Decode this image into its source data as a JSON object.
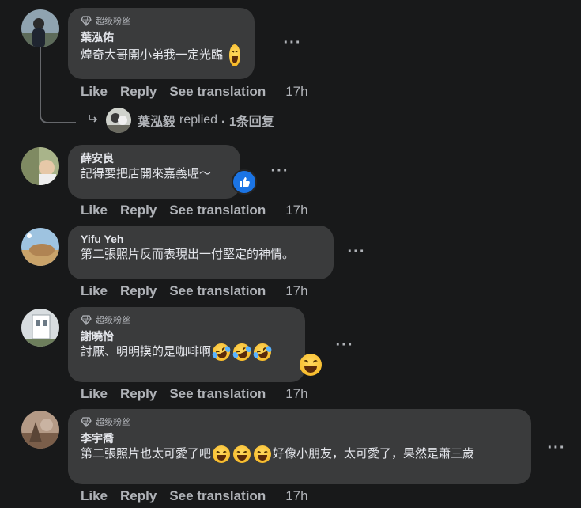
{
  "badge_label": "超级粉丝",
  "actions": {
    "like": "Like",
    "reply": "Reply",
    "translate": "See translation"
  },
  "comments": [
    {
      "author": "葉泓佑",
      "text": "煌奇大哥開小弟我一定光臨",
      "time": "17h",
      "has_badge": true
    },
    {
      "author": "薛安良",
      "text": "記得要把店開來嘉義喔～",
      "time": "17h",
      "has_badge": false
    },
    {
      "author": "Yifu Yeh",
      "text": "第二張照片反而表現出一付堅定的神情。",
      "time": "17h",
      "has_badge": false
    },
    {
      "author": "謝曉怡",
      "text": "討厭、明明摸的是咖啡啊",
      "time": "17h",
      "has_badge": true
    },
    {
      "author": "李宇喬",
      "text_before": "第二張照片也太可愛了吧",
      "text_after": "好像小朋友，太可愛了，果然是蕭三歲",
      "time": "17h",
      "has_badge": true
    }
  ],
  "reply_summary": {
    "author": "葉泓毅",
    "verb": "replied",
    "count": "· 1条回复"
  },
  "icons": {
    "badge": "diamond-icon",
    "more": "more-options-icon",
    "reply_arrow": "reply-arrow-icon",
    "like_reaction": "thumbs-up-reaction-icon",
    "emoji_grin": "squinting-laugh-emoji",
    "emoji_rofl": "rolling-on-floor-laughing-emoji"
  },
  "colors": {
    "background": "#18191a",
    "bubble": "#3a3b3c",
    "text": "#e4e6eb",
    "secondary": "#b0b3b8",
    "like_blue": "#1b74e4"
  }
}
